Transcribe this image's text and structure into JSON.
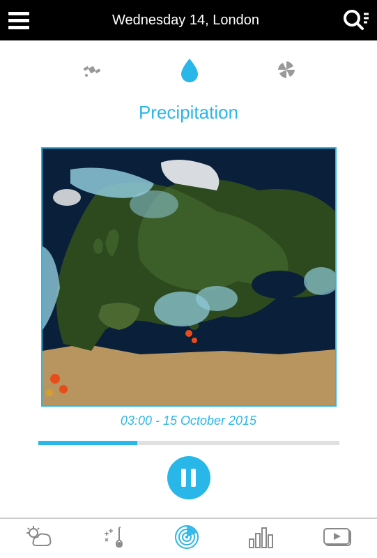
{
  "header": {
    "title": "Wednesday 14, London"
  },
  "viewTabs": {
    "active": "precipitation"
  },
  "section": {
    "title": "Precipitation"
  },
  "timeline": {
    "label": "03:00 - 15 October 2015",
    "progressPercent": 33
  },
  "colors": {
    "accent": "#29b6e8",
    "inactive": "#888888"
  }
}
